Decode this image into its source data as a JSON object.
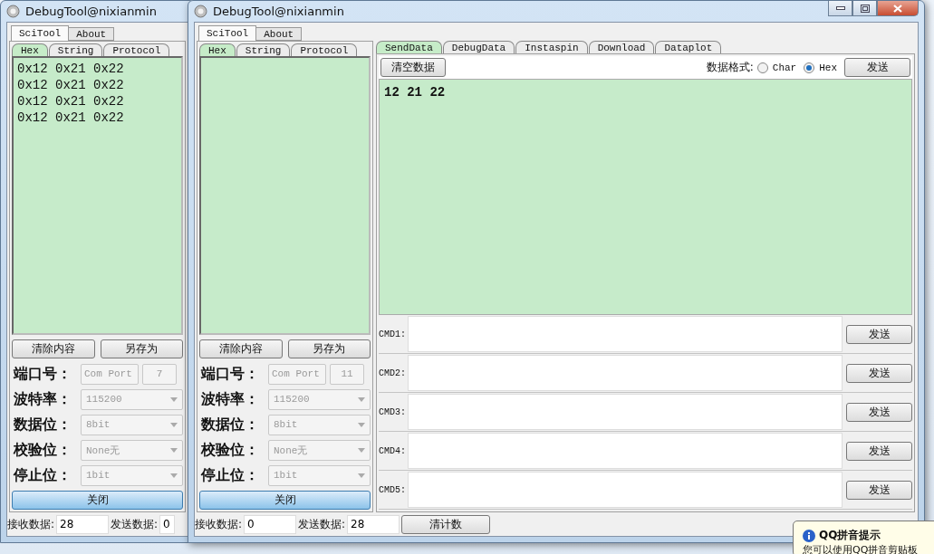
{
  "windows": [
    {
      "kind": "back",
      "title": "DebugTool@nixianmin",
      "main_tabs": [
        {
          "label": "SciTool",
          "selected": true
        },
        {
          "label": "About",
          "selected": false
        }
      ],
      "view_tabs": [
        {
          "label": "Hex",
          "selected": true
        },
        {
          "label": "String",
          "selected": false
        },
        {
          "label": "Protocol",
          "selected": false
        }
      ],
      "log_lines": [
        "0x12 0x21 0x22",
        "0x12 0x21 0x22",
        "0x12 0x21 0x22",
        "0x12 0x21 0x22"
      ],
      "log_buttons": [
        "清除内容",
        "另存为"
      ],
      "port": {
        "label": "端口号：",
        "name": "Com Port",
        "number": "7"
      },
      "settings": [
        {
          "label": "波特率：",
          "value": "115200"
        },
        {
          "label": "数据位：",
          "value": "8bit"
        },
        {
          "label": "校验位：",
          "value": "None无"
        },
        {
          "label": "停止位：",
          "value": "1bit"
        }
      ],
      "close_button": "关闭",
      "status": {
        "received_label": "接收数据:",
        "received": "28",
        "sent_label": "发送数据:",
        "sent": "0"
      }
    },
    {
      "kind": "front",
      "title": "DebugTool@nixianmin",
      "main_tabs": [
        {
          "label": "SciTool",
          "selected": true
        },
        {
          "label": "About",
          "selected": false
        }
      ],
      "view_tabs": [
        {
          "label": "Hex",
          "selected": true
        },
        {
          "label": "String",
          "selected": false
        },
        {
          "label": "Protocol",
          "selected": false
        }
      ],
      "log_buttons": [
        "清除内容",
        "另存为"
      ],
      "port": {
        "label": "端口号：",
        "name": "Com Port",
        "number": "11"
      },
      "settings": [
        {
          "label": "波特率：",
          "value": "115200"
        },
        {
          "label": "数据位：",
          "value": "8bit"
        },
        {
          "label": "校验位：",
          "value": "None无"
        },
        {
          "label": "停止位：",
          "value": "1bit"
        }
      ],
      "close_button": "关闭",
      "status": {
        "received_label": "接收数据:",
        "received": "0",
        "sent_label": "发送数据:",
        "sent": "28",
        "reset_button": "清计数"
      },
      "send_panel": {
        "tabs": [
          {
            "label": "SendData",
            "selected": true
          },
          {
            "label": "DebugData",
            "selected": false
          },
          {
            "label": "Instaspin",
            "selected": false
          },
          {
            "label": "Download",
            "selected": false
          },
          {
            "label": "Dataplot",
            "selected": false
          }
        ],
        "clear_button": "清空数据",
        "format_label": "数据格式:",
        "formats": [
          {
            "label": "Char",
            "selected": false
          },
          {
            "label": "Hex",
            "selected": true
          }
        ],
        "send_button": "发送",
        "send_text": "12 21 22",
        "commands": [
          {
            "label": "CMD1:",
            "button": "发送"
          },
          {
            "label": "CMD2:",
            "button": "发送"
          },
          {
            "label": "CMD3:",
            "button": "发送"
          },
          {
            "label": "CMD4:",
            "button": "发送"
          },
          {
            "label": "CMD5:",
            "button": "发送"
          }
        ]
      }
    }
  ],
  "notification": {
    "title": "QQ拼音提示",
    "text": "您可以使用QQ拼音剪贴板"
  }
}
